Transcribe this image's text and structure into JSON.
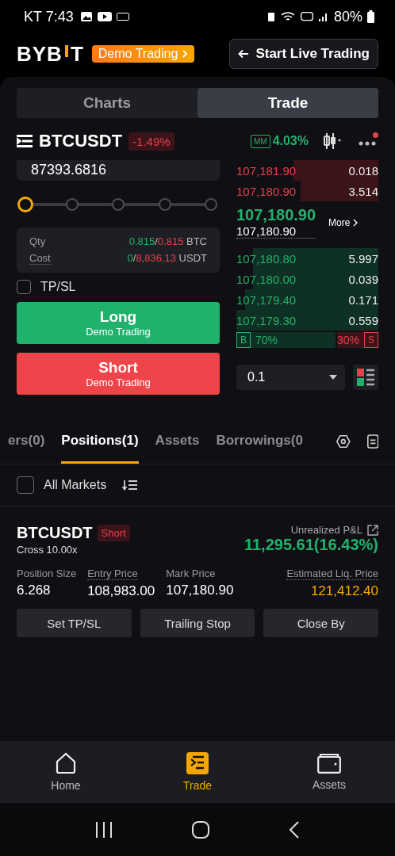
{
  "status_bar": {
    "time": "KT 7:43",
    "battery": "80%"
  },
  "header": {
    "logo_head": "BYB",
    "logo_tail": "T",
    "badge": "Demo Trading",
    "live_button": "Start Live Trading"
  },
  "view_tabs": [
    {
      "label": "Charts",
      "selected": false
    },
    {
      "label": "Trade",
      "selected": true
    }
  ],
  "symbol": {
    "name": "BTCUSDT",
    "change": "-1.49%",
    "mm_badge": "MM",
    "mm_value": "4.03%",
    "notification": true
  },
  "order_form": {
    "price": "87393.6816",
    "slider": {
      "level": 0
    },
    "qty_label": "Qty",
    "qty_available": "0.815",
    "qty_sep": "/",
    "qty_max": "0.815",
    "qty_unit": "BTC",
    "cost_label": "Cost",
    "cost_used": "0",
    "cost_sep": "/",
    "cost_max": "8,836.13",
    "cost_unit": "USDT",
    "tpsl": {
      "label": "TP/SL",
      "checked": false
    },
    "buttons": [
      {
        "kind": "long",
        "label": "Long",
        "sub": "Demo Trading"
      },
      {
        "kind": "short",
        "label": "Short",
        "sub": "Demo Trading"
      }
    ]
  },
  "order_book": {
    "asks": [
      {
        "price": "107,181.90",
        "size": "0.018"
      },
      {
        "price": "107,180.90",
        "size": "3.514"
      }
    ],
    "last_price": "107,180.90",
    "mark_price": "107,180.90",
    "more": "More",
    "bids": [
      {
        "price": "107,180.80",
        "size": "5.997"
      },
      {
        "price": "107,180.00",
        "size": "0.039"
      },
      {
        "price": "107,179.40",
        "size": "0.171"
      },
      {
        "price": "107,179.30",
        "size": "0.559"
      }
    ],
    "buy_label": "B",
    "buy_pct": "70%",
    "sell_pct": "30%",
    "sell_label": "S",
    "ratio": {
      "level": 0.7
    },
    "tick_size": "0.1"
  },
  "position_tabs": [
    {
      "label": "ers(0)",
      "selected": false
    },
    {
      "label": "Positions(1)",
      "selected": true
    },
    {
      "label": "Assets",
      "selected": false
    },
    {
      "label": "Borrowings(0",
      "selected": false
    }
  ],
  "filter": {
    "label": "All Markets",
    "checked": false
  },
  "position": {
    "symbol": "BTCUSDT",
    "side": "Short",
    "margin": "Cross 10.00x",
    "pnl_label": "Unrealized P&L",
    "pnl": "11,295.61(16.43%)",
    "fields": [
      {
        "label": "Position Size",
        "value": "6.268",
        "hint": false,
        "kind": "plain"
      },
      {
        "label": "Entry Price",
        "value": "108,983.00",
        "hint": true,
        "kind": "plain"
      },
      {
        "label": "Mark Price",
        "value": "107,180.90",
        "hint": false,
        "kind": "plain"
      },
      {
        "label": "Estimated Liq. Price",
        "value": "121,412.40",
        "hint": true,
        "kind": "warn"
      }
    ],
    "actions": [
      "Set TP/SL",
      "Trailing Stop",
      "Close By"
    ]
  },
  "nav": [
    {
      "label": "Home",
      "selected": false
    },
    {
      "label": "Trade",
      "selected": true
    },
    {
      "label": "Assets",
      "selected": false
    }
  ]
}
